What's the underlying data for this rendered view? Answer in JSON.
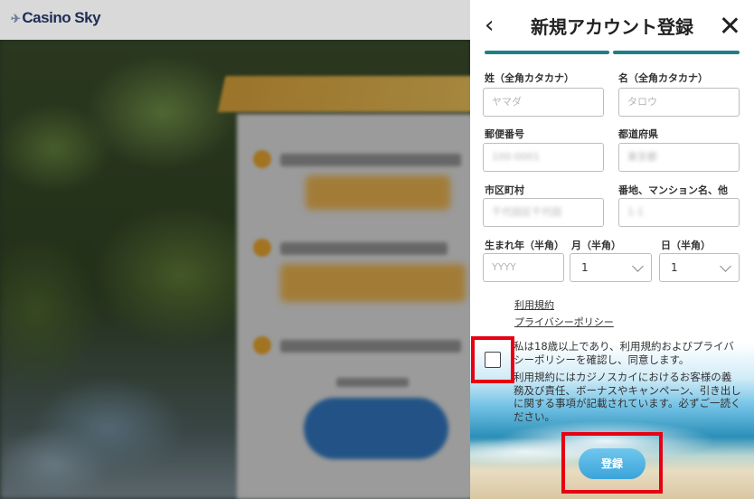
{
  "background": {
    "logo": "Casino Sky"
  },
  "modal": {
    "title": "新規アカウント登録",
    "fields": {
      "last_name_kana": {
        "label": "姓（全角カタカナ）",
        "placeholder": "ヤマダ"
      },
      "first_name_kana": {
        "label": "名（全角カタカナ）",
        "placeholder": "タロウ"
      },
      "postal_code": {
        "label": "郵便番号",
        "value": "100-0001"
      },
      "prefecture": {
        "label": "都道府県",
        "value": "東京都"
      },
      "city": {
        "label": "市区町村",
        "value": "千代田区千代田"
      },
      "address": {
        "label": "番地、マンション名、他",
        "value": "1-1"
      },
      "birth_year": {
        "label": "生まれ年（半角）",
        "placeholder": "YYYY"
      },
      "birth_month": {
        "label": "月（半角）",
        "value": "1"
      },
      "birth_day": {
        "label": "日（半角）",
        "value": "1"
      }
    },
    "links": {
      "terms": "利用規約",
      "privacy": "プライバシーポリシー"
    },
    "agreement": {
      "text": "私は18歳以上であり、利用規約およびプライバシーポリシーを確認し、同意します。",
      "note": "利用規約にはカジノスカイにおけるお客様の義務及び責任、ボーナスやキャンペーン、引き出しに関する事項が記載されています。必ずご一読ください。",
      "checked": false
    },
    "register_label": "登録"
  },
  "colors": {
    "accent_teal": "#1f7f86",
    "highlight_red": "#e60012",
    "register_blue": "#3aa3d9"
  }
}
